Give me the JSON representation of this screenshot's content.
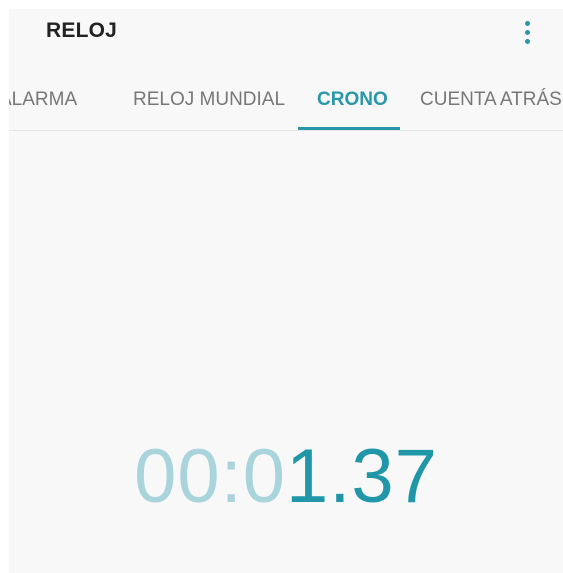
{
  "app": {
    "title": "RELOJ"
  },
  "header": {
    "menu_icon": "more-vert-icon"
  },
  "tabs": [
    {
      "label": "ALARMA",
      "active": false
    },
    {
      "label": "RELOJ MUNDIAL",
      "active": false
    },
    {
      "label": "CRONO",
      "active": true
    },
    {
      "label": "CUENTA ATRÁS",
      "active": false
    }
  ],
  "stopwatch": {
    "inactive_part": "00:0",
    "active_part": "1.37"
  },
  "colors": {
    "accent": "#2a97a8",
    "accent_dim": "#a9d4dc",
    "background": "#f8f8f8",
    "title_text": "#222222",
    "inactive_tab_text": "#777777"
  }
}
